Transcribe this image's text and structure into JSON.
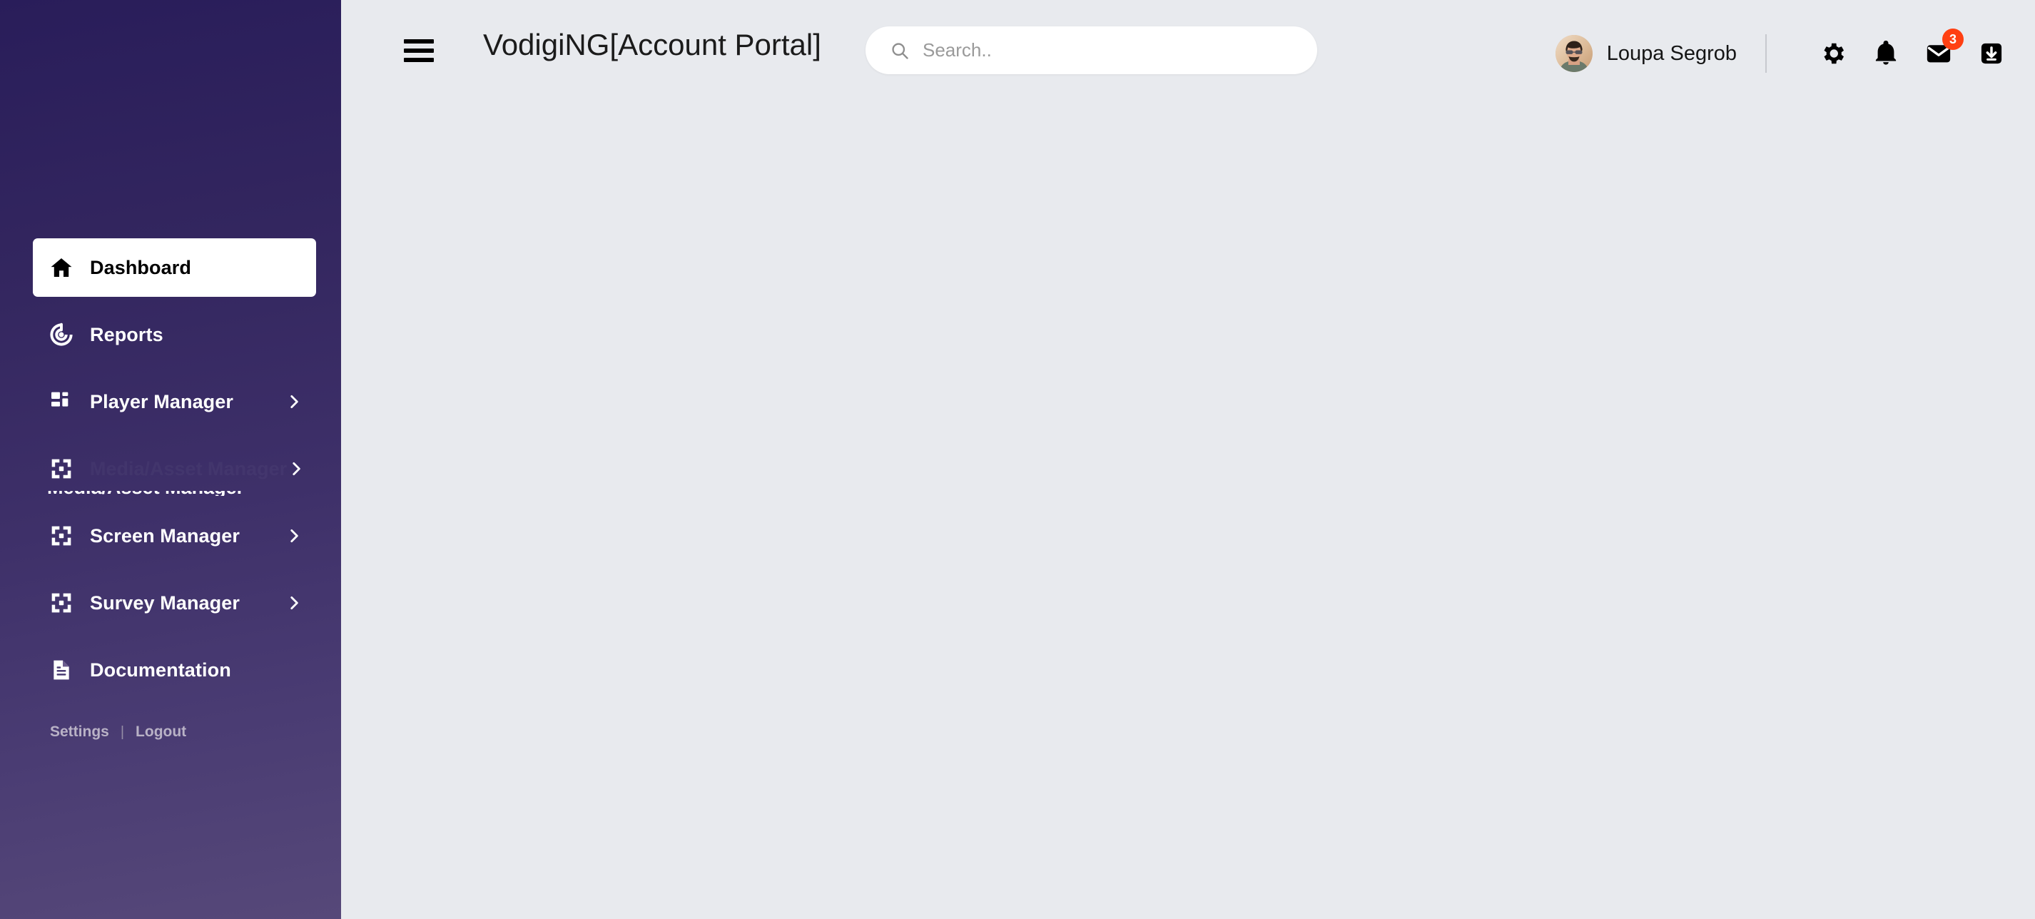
{
  "app": {
    "title": "VodigiNG[Account Portal]",
    "background_color": "#e8eaee",
    "sidebar_gradient_top": "#291d5a",
    "sidebar_gradient_bottom": "#564879",
    "badge_color": "#ff4012"
  },
  "header": {
    "menu_toggle_name": "hamburger-menu",
    "title": "VodigiNG[Account Portal]",
    "search": {
      "placeholder": "Search..",
      "value": "",
      "icon": "search-icon"
    },
    "user": {
      "name": "Loupa Segrob",
      "avatar": "user-avatar-photo"
    },
    "actions": [
      {
        "name": "settings-icon",
        "label": "Settings",
        "badge": ""
      },
      {
        "name": "notifications-bell-icon",
        "label": "Notifications",
        "badge": ""
      },
      {
        "name": "mail-icon",
        "label": "Messages",
        "badge": "3"
      },
      {
        "name": "download-inbox-icon",
        "label": "Downloads",
        "badge": ""
      }
    ]
  },
  "sidebar": {
    "items": [
      {
        "label": "Dashboard",
        "icon": "home-icon",
        "active": true,
        "chevron": false
      },
      {
        "label": "Reports",
        "icon": "radar-icon",
        "active": false,
        "chevron": false
      },
      {
        "label": "Player Manager",
        "icon": "grid-icon",
        "active": false,
        "chevron": true
      },
      {
        "label": "Media/Asset",
        "icon": "expand-icon",
        "active": false,
        "chevron": true,
        "glitched": true,
        "ghost_label": "Media/Asset Manager"
      },
      {
        "label": "Screen Manager",
        "icon": "expand-icon",
        "active": false,
        "chevron": true
      },
      {
        "label": "Survey Manager",
        "icon": "expand-icon",
        "active": false,
        "chevron": true
      },
      {
        "label": "Documentation",
        "icon": "document-icon",
        "active": false,
        "chevron": false
      }
    ],
    "footer": {
      "settings_label": "Settings",
      "separator": "|",
      "logout_label": "Logout"
    }
  },
  "main": {
    "content": ""
  }
}
